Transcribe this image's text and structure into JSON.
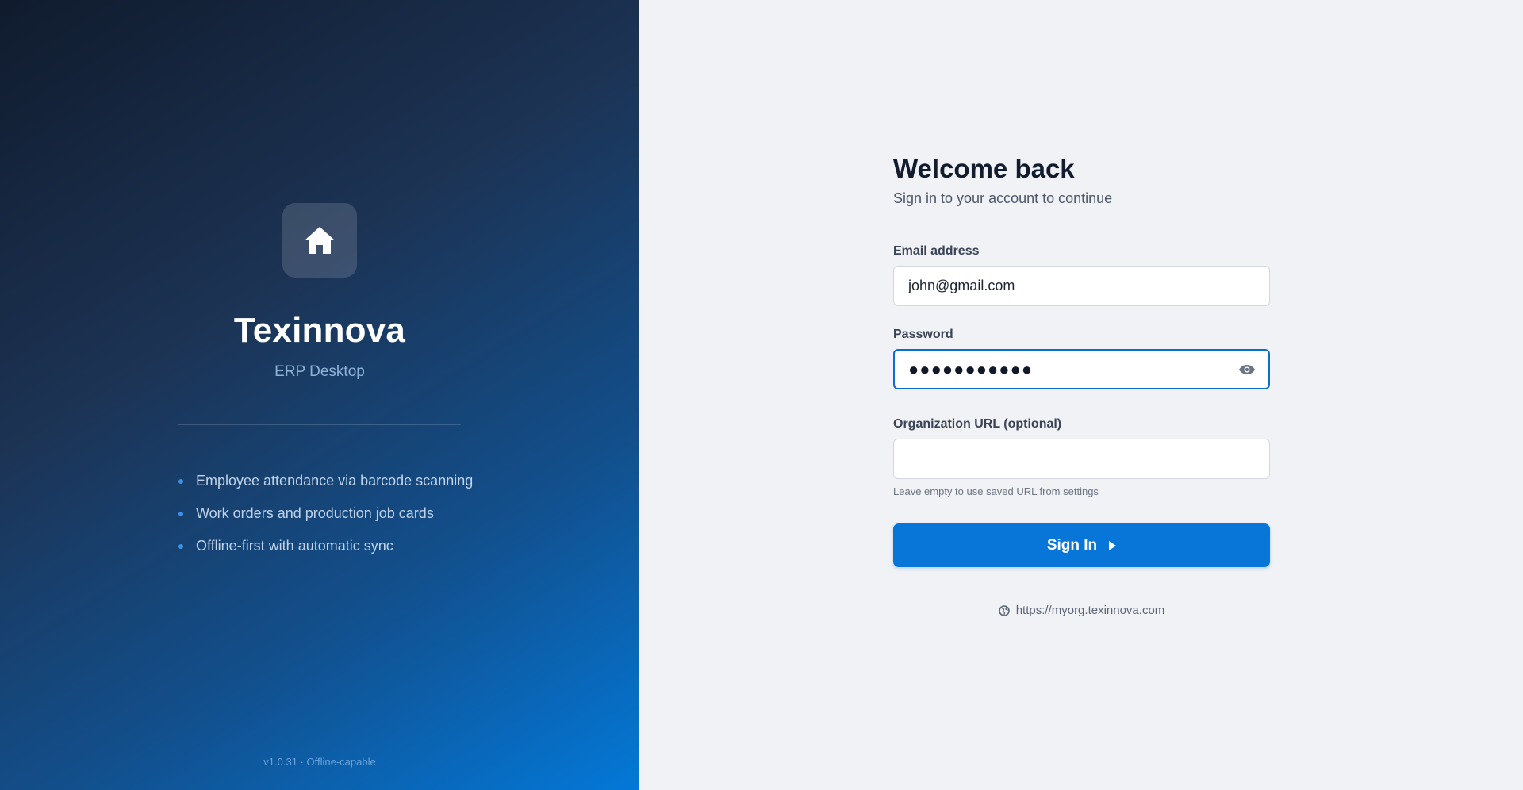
{
  "brand": {
    "name": "Texinnova",
    "subtitle": "ERP Desktop",
    "logo_icon": "home-icon",
    "features": [
      "Employee attendance via barcode scanning",
      "Work orders and production job cards",
      "Offline-first with automatic sync"
    ],
    "version": "v1.0.31 · Offline-capable"
  },
  "form": {
    "title": "Welcome back",
    "subtitle": "Sign in to your account to continue",
    "email": {
      "label": "Email address",
      "value": "john@gmail.com"
    },
    "password": {
      "label": "Password",
      "value": "●●●●●●●●●●●",
      "toggle_icon": "eye-icon"
    },
    "org_url": {
      "label": "Organization URL (optional)",
      "value": "",
      "hint": "Leave empty to use saved URL from settings"
    },
    "submit_label": "Sign In",
    "submit_icon": "play-arrow-icon",
    "current_org": {
      "icon": "globe-icon",
      "url": "https://myorg.texinnova.com"
    }
  },
  "colors": {
    "accent": "#0875d8",
    "panel_dark": "#101b2d",
    "panel_light": "#0378d8",
    "page_bg": "#f1f2f5"
  }
}
